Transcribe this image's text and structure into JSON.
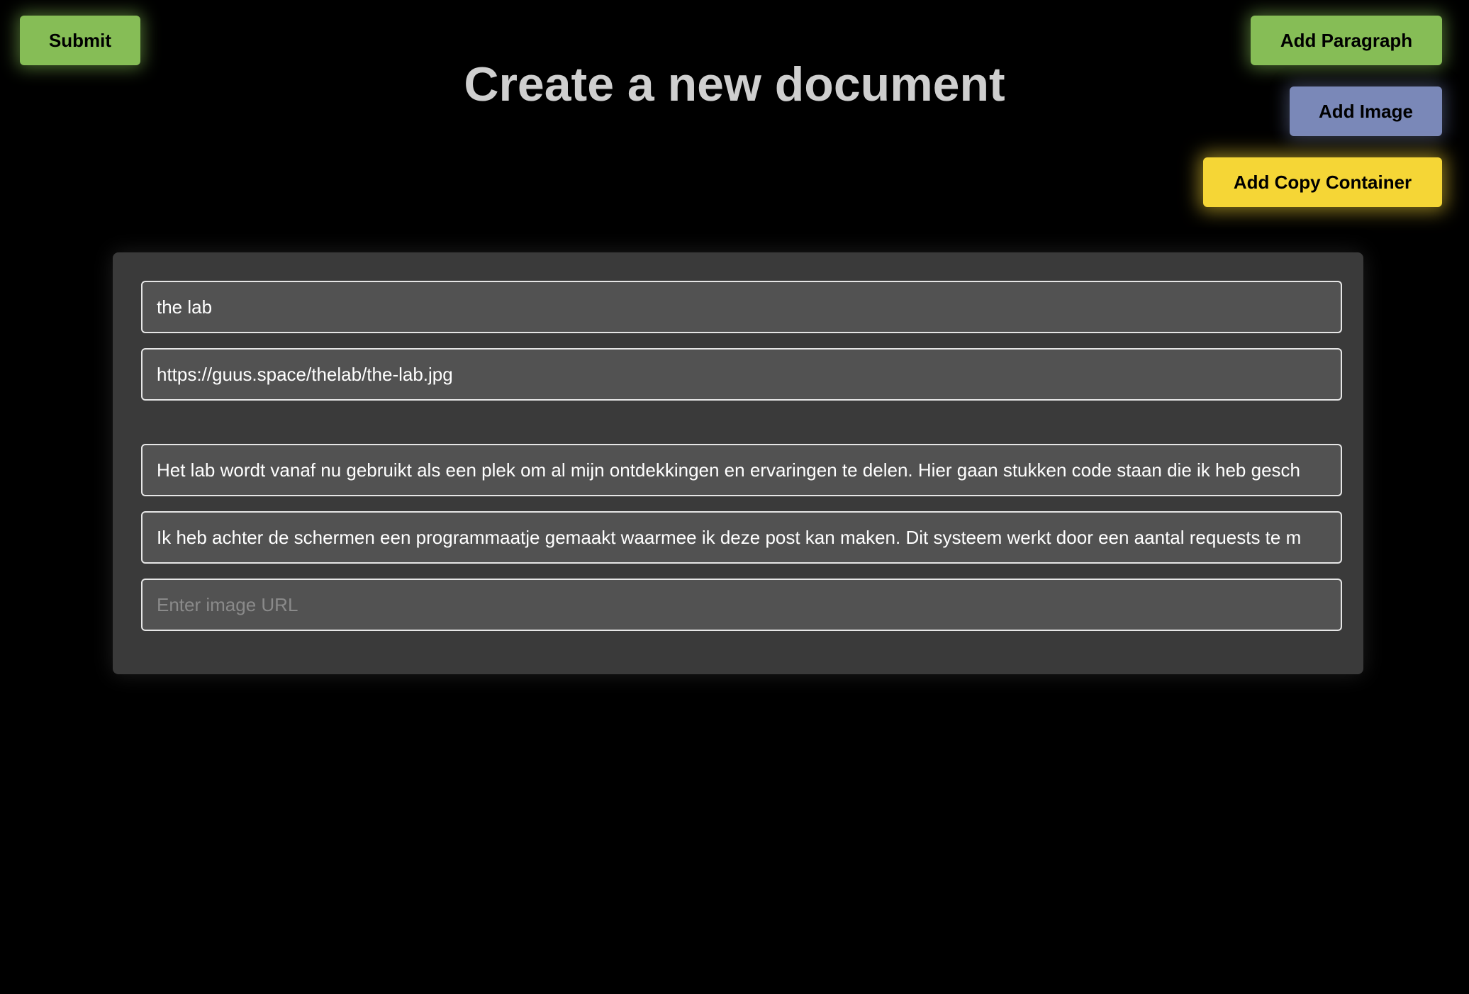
{
  "toolbar": {
    "submit_label": "Submit",
    "add_paragraph_label": "Add Paragraph",
    "add_image_label": "Add Image",
    "add_copy_container_label": "Add Copy Container"
  },
  "page": {
    "title": "Create a new document"
  },
  "form": {
    "title_value": "the lab",
    "cover_url_value": "https://guus.space/thelab/the-lab.jpg",
    "paragraph_1_value": "Het lab wordt vanaf nu gebruikt als een plek om al mijn ontdekkingen en ervaringen te delen. Hier gaan stukken code staan die ik heb gesch",
    "paragraph_2_value": "Ik heb achter de schermen een programmaatje gemaakt waarmee ik deze post kan maken. Dit systeem werkt door een aantal requests te m",
    "image_url_value": "",
    "image_url_placeholder": "Enter image URL"
  },
  "colors": {
    "background": "#000000",
    "panel": "#3a3a3a",
    "field": "#525252",
    "green_button": "#86bd56",
    "blue_button": "#7a88b8",
    "yellow_button": "#f5d636",
    "title_text": "#cfcfcf"
  }
}
